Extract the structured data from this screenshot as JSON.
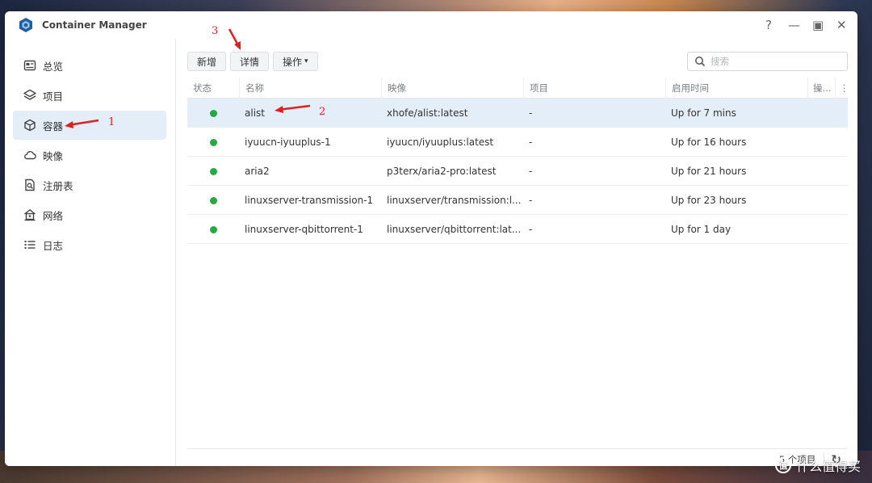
{
  "app": {
    "title": "Container Manager",
    "help": "?",
    "minimize": "—",
    "maximize": "▣",
    "close": "✕"
  },
  "sidebar": {
    "items": [
      {
        "label": "总览",
        "icon": "overview-icon",
        "active": false
      },
      {
        "label": "项目",
        "icon": "project-layers-icon",
        "active": false
      },
      {
        "label": "容器",
        "icon": "container-cube-icon",
        "active": true
      },
      {
        "label": "映像",
        "icon": "image-cloud-icon",
        "active": false
      },
      {
        "label": "注册表",
        "icon": "registry-search-icon",
        "active": false
      },
      {
        "label": "网络",
        "icon": "network-home-icon",
        "active": false
      },
      {
        "label": "日志",
        "icon": "log-list-icon",
        "active": false
      }
    ]
  },
  "toolbar": {
    "new_label": "新增",
    "details_label": "详情",
    "actions_label": "操作",
    "actions_caret": "▾"
  },
  "search": {
    "placeholder": "搜索",
    "value": ""
  },
  "table": {
    "columns": [
      "状态",
      "名称",
      "映像",
      "项目",
      "启用时间",
      "操..."
    ],
    "more": "⋮",
    "rows": [
      {
        "status": "running",
        "name": "alist",
        "image": "xhofe/alist:latest",
        "project": "-",
        "uptime": "Up for 7 mins",
        "selected": true
      },
      {
        "status": "running",
        "name": "iyuucn-iyuuplus-1",
        "image": "iyuucn/iyuuplus:latest",
        "project": "-",
        "uptime": "Up for 16 hours",
        "selected": false
      },
      {
        "status": "running",
        "name": "aria2",
        "image": "p3terx/aria2-pro:latest",
        "project": "-",
        "uptime": "Up for 21 hours",
        "selected": false
      },
      {
        "status": "running",
        "name": "linuxserver-transmission-1",
        "image": "linuxserver/transmission:l...",
        "project": "-",
        "uptime": "Up for 23 hours",
        "selected": false
      },
      {
        "status": "running",
        "name": "linuxserver-qbittorrent-1",
        "image": "linuxserver/qbittorrent:lat...",
        "project": "-",
        "uptime": "Up for 1 day",
        "selected": false
      }
    ]
  },
  "footer": {
    "count": "5 个项目",
    "refresh": "↻"
  },
  "annotations": {
    "one": "1",
    "two": "2",
    "three": "3"
  },
  "watermark": {
    "logo": "值",
    "text": "什么值得买"
  },
  "colors": {
    "running": "#28a745",
    "selection": "#e4eef8",
    "annotation": "#e02020",
    "brand": "#1e5fa8"
  }
}
